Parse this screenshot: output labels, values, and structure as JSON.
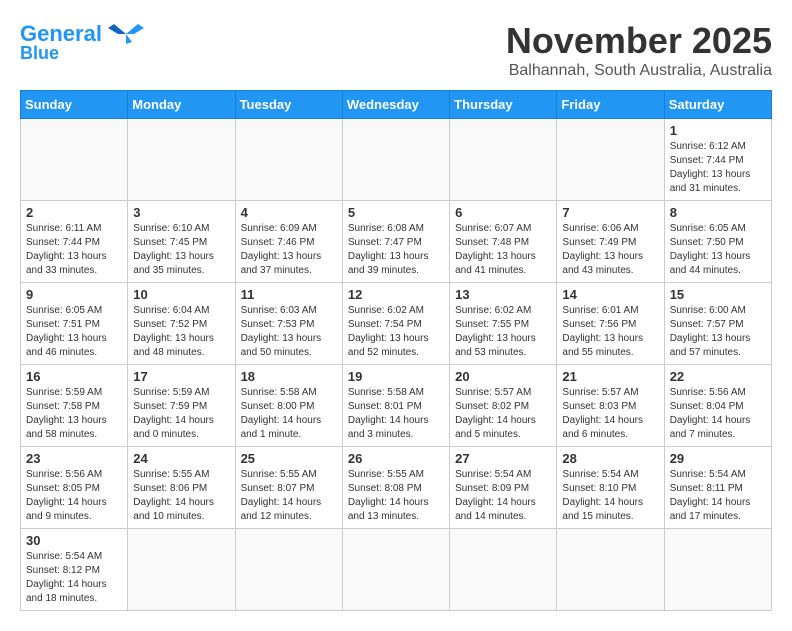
{
  "header": {
    "logo_line1": "General",
    "logo_line2": "Blue",
    "month": "November 2025",
    "location": "Balhannah, South Australia, Australia"
  },
  "days_of_week": [
    "Sunday",
    "Monday",
    "Tuesday",
    "Wednesday",
    "Thursday",
    "Friday",
    "Saturday"
  ],
  "weeks": [
    [
      {
        "day": "",
        "info": ""
      },
      {
        "day": "",
        "info": ""
      },
      {
        "day": "",
        "info": ""
      },
      {
        "day": "",
        "info": ""
      },
      {
        "day": "",
        "info": ""
      },
      {
        "day": "",
        "info": ""
      },
      {
        "day": "1",
        "info": "Sunrise: 6:12 AM\nSunset: 7:44 PM\nDaylight: 13 hours\nand 31 minutes."
      }
    ],
    [
      {
        "day": "2",
        "info": "Sunrise: 6:11 AM\nSunset: 7:44 PM\nDaylight: 13 hours\nand 33 minutes."
      },
      {
        "day": "3",
        "info": "Sunrise: 6:10 AM\nSunset: 7:45 PM\nDaylight: 13 hours\nand 35 minutes."
      },
      {
        "day": "4",
        "info": "Sunrise: 6:09 AM\nSunset: 7:46 PM\nDaylight: 13 hours\nand 37 minutes."
      },
      {
        "day": "5",
        "info": "Sunrise: 6:08 AM\nSunset: 7:47 PM\nDaylight: 13 hours\nand 39 minutes."
      },
      {
        "day": "6",
        "info": "Sunrise: 6:07 AM\nSunset: 7:48 PM\nDaylight: 13 hours\nand 41 minutes."
      },
      {
        "day": "7",
        "info": "Sunrise: 6:06 AM\nSunset: 7:49 PM\nDaylight: 13 hours\nand 43 minutes."
      },
      {
        "day": "8",
        "info": "Sunrise: 6:05 AM\nSunset: 7:50 PM\nDaylight: 13 hours\nand 44 minutes."
      }
    ],
    [
      {
        "day": "9",
        "info": "Sunrise: 6:05 AM\nSunset: 7:51 PM\nDaylight: 13 hours\nand 46 minutes."
      },
      {
        "day": "10",
        "info": "Sunrise: 6:04 AM\nSunset: 7:52 PM\nDaylight: 13 hours\nand 48 minutes."
      },
      {
        "day": "11",
        "info": "Sunrise: 6:03 AM\nSunset: 7:53 PM\nDaylight: 13 hours\nand 50 minutes."
      },
      {
        "day": "12",
        "info": "Sunrise: 6:02 AM\nSunset: 7:54 PM\nDaylight: 13 hours\nand 52 minutes."
      },
      {
        "day": "13",
        "info": "Sunrise: 6:02 AM\nSunset: 7:55 PM\nDaylight: 13 hours\nand 53 minutes."
      },
      {
        "day": "14",
        "info": "Sunrise: 6:01 AM\nSunset: 7:56 PM\nDaylight: 13 hours\nand 55 minutes."
      },
      {
        "day": "15",
        "info": "Sunrise: 6:00 AM\nSunset: 7:57 PM\nDaylight: 13 hours\nand 57 minutes."
      }
    ],
    [
      {
        "day": "16",
        "info": "Sunrise: 5:59 AM\nSunset: 7:58 PM\nDaylight: 13 hours\nand 58 minutes."
      },
      {
        "day": "17",
        "info": "Sunrise: 5:59 AM\nSunset: 7:59 PM\nDaylight: 14 hours\nand 0 minutes."
      },
      {
        "day": "18",
        "info": "Sunrise: 5:58 AM\nSunset: 8:00 PM\nDaylight: 14 hours\nand 1 minute."
      },
      {
        "day": "19",
        "info": "Sunrise: 5:58 AM\nSunset: 8:01 PM\nDaylight: 14 hours\nand 3 minutes."
      },
      {
        "day": "20",
        "info": "Sunrise: 5:57 AM\nSunset: 8:02 PM\nDaylight: 14 hours\nand 5 minutes."
      },
      {
        "day": "21",
        "info": "Sunrise: 5:57 AM\nSunset: 8:03 PM\nDaylight: 14 hours\nand 6 minutes."
      },
      {
        "day": "22",
        "info": "Sunrise: 5:56 AM\nSunset: 8:04 PM\nDaylight: 14 hours\nand 7 minutes."
      }
    ],
    [
      {
        "day": "23",
        "info": "Sunrise: 5:56 AM\nSunset: 8:05 PM\nDaylight: 14 hours\nand 9 minutes."
      },
      {
        "day": "24",
        "info": "Sunrise: 5:55 AM\nSunset: 8:06 PM\nDaylight: 14 hours\nand 10 minutes."
      },
      {
        "day": "25",
        "info": "Sunrise: 5:55 AM\nSunset: 8:07 PM\nDaylight: 14 hours\nand 12 minutes."
      },
      {
        "day": "26",
        "info": "Sunrise: 5:55 AM\nSunset: 8:08 PM\nDaylight: 14 hours\nand 13 minutes."
      },
      {
        "day": "27",
        "info": "Sunrise: 5:54 AM\nSunset: 8:09 PM\nDaylight: 14 hours\nand 14 minutes."
      },
      {
        "day": "28",
        "info": "Sunrise: 5:54 AM\nSunset: 8:10 PM\nDaylight: 14 hours\nand 15 minutes."
      },
      {
        "day": "29",
        "info": "Sunrise: 5:54 AM\nSunset: 8:11 PM\nDaylight: 14 hours\nand 17 minutes."
      }
    ],
    [
      {
        "day": "30",
        "info": "Sunrise: 5:54 AM\nSunset: 8:12 PM\nDaylight: 14 hours\nand 18 minutes."
      },
      {
        "day": "",
        "info": ""
      },
      {
        "day": "",
        "info": ""
      },
      {
        "day": "",
        "info": ""
      },
      {
        "day": "",
        "info": ""
      },
      {
        "day": "",
        "info": ""
      },
      {
        "day": "",
        "info": ""
      }
    ]
  ]
}
